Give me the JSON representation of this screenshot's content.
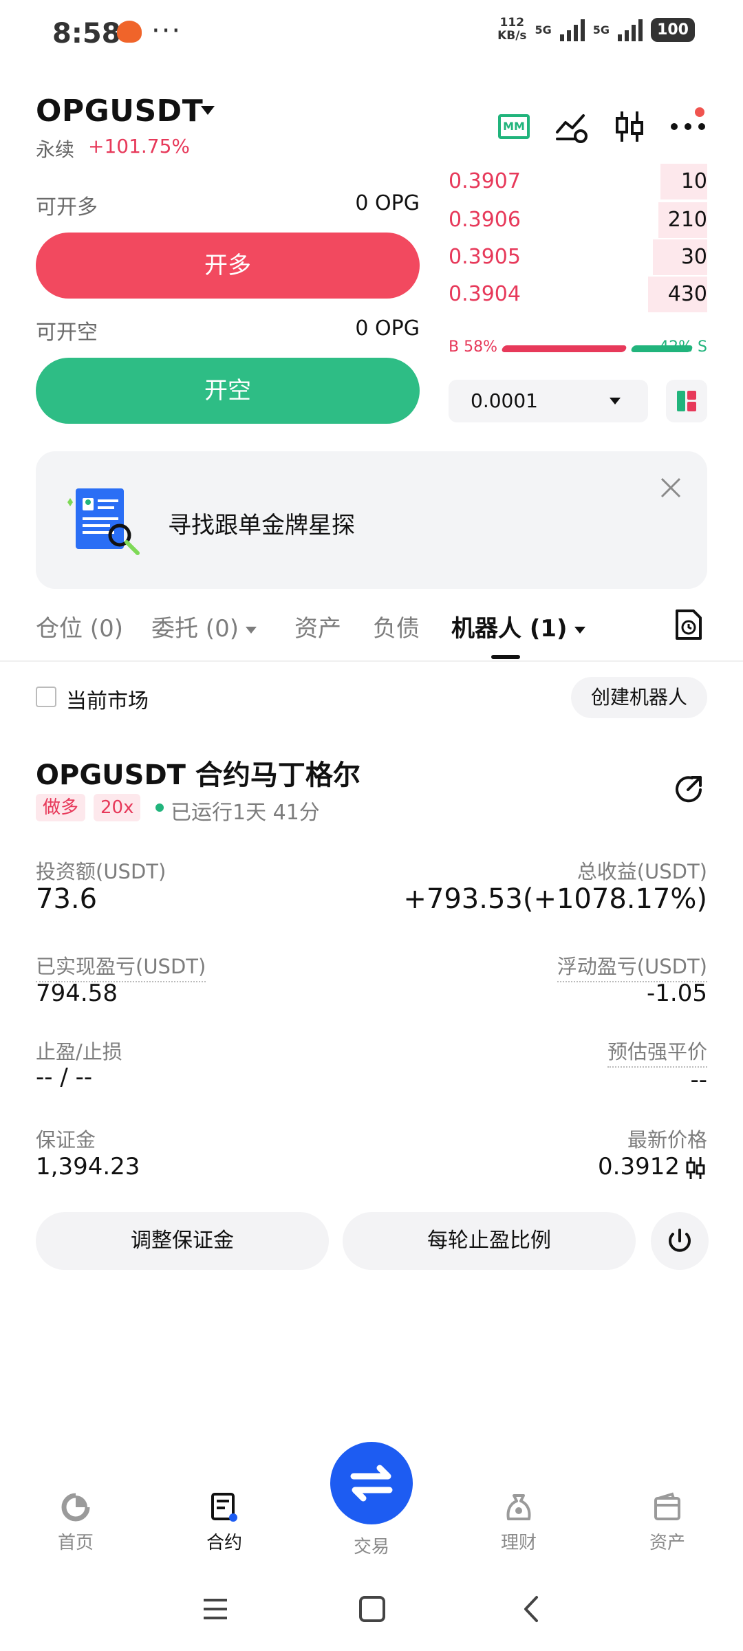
{
  "status_bar": {
    "time": "8:58",
    "more": "···",
    "net_speed_value": "112",
    "net_speed_unit": "KB/s",
    "sim1": "5G",
    "sim2": "5G",
    "battery": "100"
  },
  "header": {
    "pair": "OPGUSDT",
    "contract_type": "永续",
    "change": "+101.75%"
  },
  "trade": {
    "long_available_label": "可开多",
    "long_available_value": "0 OPG",
    "long_button": "开多",
    "short_available_label": "可开空",
    "short_available_value": "0 OPG",
    "short_button": "开空"
  },
  "order_book": {
    "asks": [
      {
        "price": "0.3907",
        "qty": "10",
        "depth": 0.18
      },
      {
        "price": "0.3906",
        "qty": "210",
        "depth": 0.19
      },
      {
        "price": "0.3905",
        "qty": "30",
        "depth": 0.21
      },
      {
        "price": "0.3904",
        "qty": "430",
        "depth": 0.23
      }
    ],
    "buy_ratio": "B 58%",
    "sell_ratio": "42% S",
    "tick_size": "0.0001"
  },
  "banner": {
    "text": "寻找跟单金牌星探"
  },
  "tabs": [
    {
      "label": "仓位 (0)"
    },
    {
      "label": "委托 (0)"
    },
    {
      "label": "资产"
    },
    {
      "label": "负债"
    },
    {
      "label": "机器人 (1)"
    }
  ],
  "filter": {
    "current_market": "当前市场",
    "create_bot": "创建机器人"
  },
  "bot": {
    "title": "OPGUSDT 合约马丁格尔",
    "side_tag": "做多",
    "leverage_tag": "20x",
    "running": "已运行1天 41分",
    "investment_label": "投资额(USDT)",
    "investment_value": "73.6",
    "total_pnl_label": "总收益(USDT)",
    "total_pnl_value": "+793.53(+1078.17%)",
    "realized_label": "已实现盈亏(USDT)",
    "realized_value": "794.58",
    "floating_label": "浮动盈亏(USDT)",
    "floating_value": "-1.05",
    "tpsl_label": "止盈/止损",
    "tpsl_value": "-- / --",
    "liq_label": "预估强平价",
    "liq_value": "--",
    "margin_label": "保证金",
    "margin_value": "1,394.23",
    "last_price_label": "最新价格",
    "last_price_value": "0.3912",
    "adjust_margin_button": "调整保证金",
    "tp_ratio_button": "每轮止盈比例"
  },
  "bottom_nav": {
    "home": "首页",
    "contract": "合约",
    "trade": "交易",
    "earn": "理财",
    "assets": "资产"
  },
  "colors": {
    "red": "#e7395a",
    "green": "#21b47c",
    "blue": "#1d5cf2"
  }
}
